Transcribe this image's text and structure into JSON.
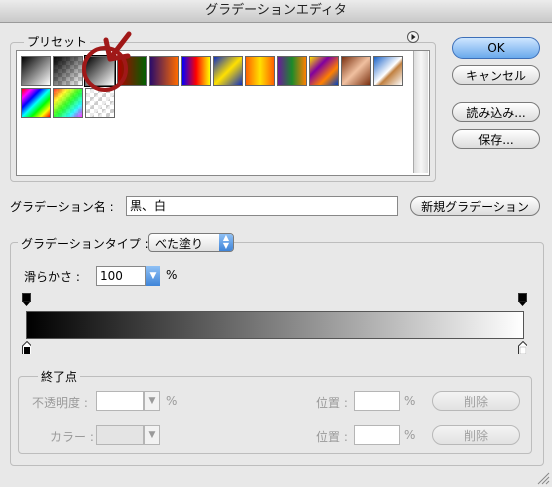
{
  "window": {
    "title": "グラデーションエディタ"
  },
  "presets": {
    "label": "プリセット",
    "menu_icon": "circle-arrow-right-icon",
    "swatches": [
      {
        "name": "fg-to-bg",
        "bg": "linear-gradient(135deg,#000,#fff)"
      },
      {
        "name": "fg-to-transparent",
        "bg": "linear-gradient(135deg,#000 0%,rgba(0,0,0,0) 100%)",
        "checker": true
      },
      {
        "name": "black-white",
        "bg": "linear-gradient(135deg,#000,#fff)",
        "selected": true
      },
      {
        "name": "red-green",
        "bg": "linear-gradient(90deg,#b00000,#006000)"
      },
      {
        "name": "violet-orange",
        "bg": "linear-gradient(90deg,#2a0c6a,#ff6a00)"
      },
      {
        "name": "blue-red-yellow",
        "bg": "linear-gradient(90deg,#0000ff,#ff0000,#ffff00)"
      },
      {
        "name": "blue-yellow-blue",
        "bg": "linear-gradient(135deg,#1030c0,#ffe000,#1030c0)"
      },
      {
        "name": "orange-yellow-orange",
        "bg": "linear-gradient(90deg,#ff6000,#ffe000,#ff6000)"
      },
      {
        "name": "violet-green-orange",
        "bg": "linear-gradient(90deg,#6a1b9a,#1b8a2a,#ff8000)"
      },
      {
        "name": "yellow-violet-orange-blue",
        "bg": "linear-gradient(135deg,#ffe000,#8000a0,#ff8000,#0040c0)"
      },
      {
        "name": "copper",
        "bg": "linear-gradient(135deg,#7a3010,#f0c0a0,#7a3010)"
      },
      {
        "name": "chrome",
        "bg": "linear-gradient(135deg,#1c64c8,#ffffff 50%,#c08040 60%,#fff)"
      },
      {
        "name": "spectrum",
        "bg": "linear-gradient(135deg,#ff0000,#ff00ff,#0000ff,#00ffff,#00ff00,#ffff00,#ff0000)"
      },
      {
        "name": "transparent-rainbow",
        "bg": "linear-gradient(135deg,rgba(255,0,0,.8),rgba(255,255,0,.8),rgba(0,255,0,.8),rgba(0,255,255,.8),rgba(255,0,255,.8))",
        "checker": true
      },
      {
        "name": "transparent-stripes",
        "bg": "repeating-linear-gradient(135deg,rgba(255,255,255,0) 0 4px,rgba(255,255,255,.6) 4px 8px)",
        "checker": true
      }
    ]
  },
  "buttons": {
    "ok": "OK",
    "cancel": "キャンセル",
    "load": "読み込み...",
    "save": "保存...",
    "new_gradient": "新規グラデーション"
  },
  "name_field": {
    "label": "グラデーション名 :",
    "value": "黒、白"
  },
  "type_group": {
    "label": "グラデーションタイプ :",
    "type_value": "べた塗り",
    "smoothness_label": "滑らかさ :",
    "smoothness_value": "100",
    "percent": "%"
  },
  "gradient_bar": {
    "start_color": "#000000",
    "end_color": "#ffffff"
  },
  "stops_group": {
    "label": "終了点",
    "opacity_label": "不透明度 :",
    "opacity_unit": "%",
    "location_label": "位置 :",
    "location_unit": "%",
    "delete_label": "削除",
    "color_label": "カラー :",
    "location_label2": "位置 :",
    "location_unit2": "%",
    "delete_label2": "削除"
  }
}
